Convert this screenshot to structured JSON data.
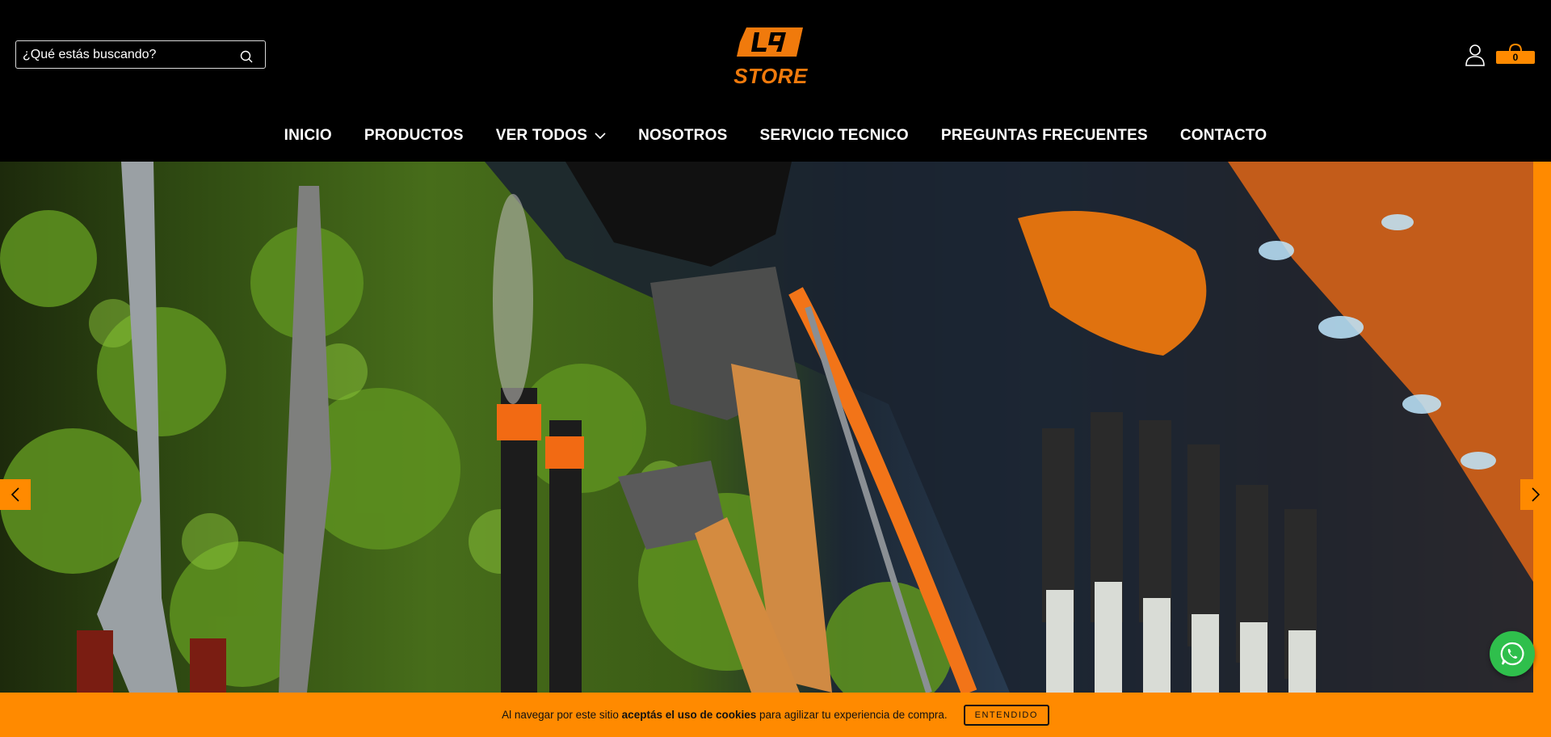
{
  "search": {
    "placeholder": "¿Qué estás buscando?"
  },
  "logo": {
    "text": "STORE",
    "mark_text": "LT",
    "color": "#f07a0c"
  },
  "cart": {
    "count": "0"
  },
  "nav": {
    "items": [
      {
        "label": "INICIO"
      },
      {
        "label": "PRODUCTOS"
      },
      {
        "label": "VER TODOS",
        "has_dropdown": true
      },
      {
        "label": "NOSOTROS"
      },
      {
        "label": "SERVICIO TECNICO"
      },
      {
        "label": "PREGUNTAS FRECUENTES"
      },
      {
        "label": "CONTACTO"
      }
    ]
  },
  "hero": {
    "image": "garden-tools-display-photo"
  },
  "cookie": {
    "text_before": "Al navegar por este sitio ",
    "text_bold": "aceptás el uso de cookies",
    "text_after": " para agilizar tu experiencia de compra.",
    "button": "ENTENDIDO"
  },
  "colors": {
    "accent": "#ff8a00",
    "header_bg": "#000000",
    "whatsapp": "#2fbf4c"
  },
  "icons": [
    "search-icon",
    "user-icon",
    "cart-icon",
    "chevron-down-icon",
    "chevron-left-icon",
    "chevron-right-icon",
    "whatsapp-icon"
  ]
}
